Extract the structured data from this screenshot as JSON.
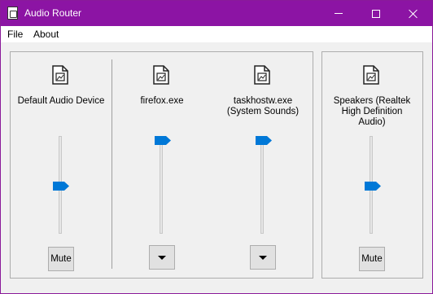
{
  "window": {
    "title": "Audio Router"
  },
  "menu": {
    "file": "File",
    "about": "About"
  },
  "channels": [
    {
      "line1": "Default Audio Device",
      "line2": "",
      "line3": "",
      "volume": 0.48,
      "control": "Mute"
    },
    {
      "line1": "firefox.exe",
      "line2": "",
      "line3": "",
      "volume": 1.0,
      "control": "dropdown"
    },
    {
      "line1": "taskhostw.exe",
      "line2": "(System Sounds)",
      "line3": "",
      "volume": 1.0,
      "control": "dropdown"
    },
    {
      "line1": "Speakers (Realtek",
      "line2": "High Definition",
      "line3": "Audio)",
      "volume": 0.48,
      "control": "Mute"
    }
  ],
  "icons": {
    "app": "audio-router-app-icon",
    "device": "document-icon",
    "dropdown": "triangle-down-icon"
  },
  "colors": {
    "titlebar": "#8c14a4",
    "slider_thumb": "#0078d7"
  }
}
